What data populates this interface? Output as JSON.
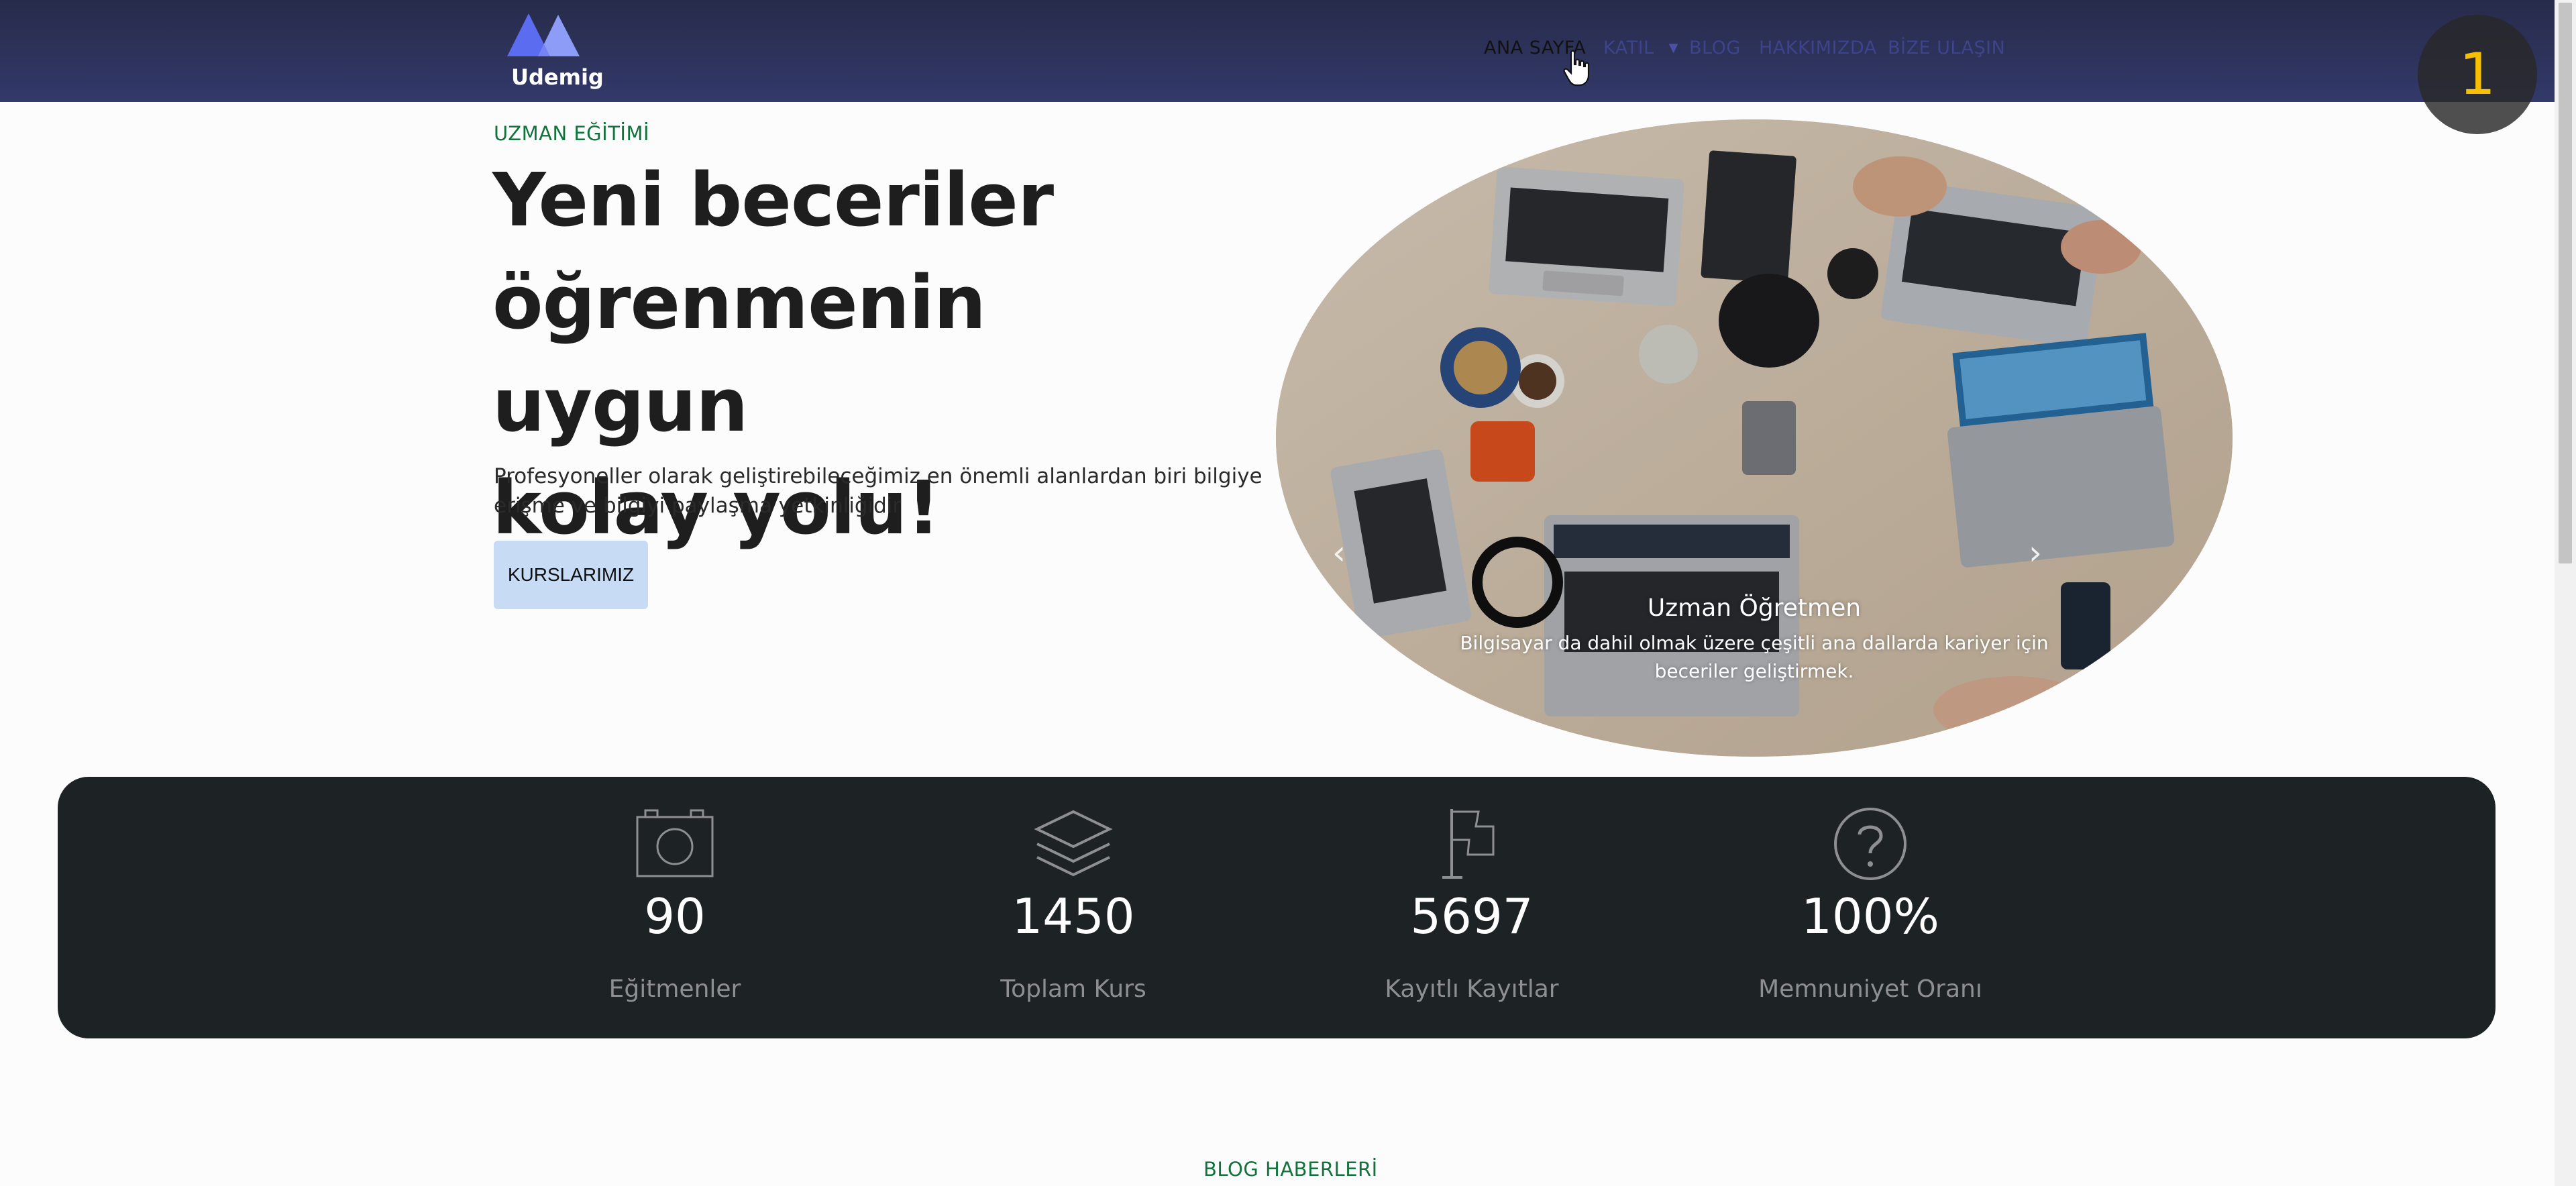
{
  "brand": {
    "name": "Udemig"
  },
  "nav": {
    "items": [
      {
        "label": "ANA SAYFA",
        "active": true
      },
      {
        "label": "KATIL",
        "has_dropdown": true
      },
      {
        "label": "BLOG"
      },
      {
        "label": "HAKKIMIZDA"
      },
      {
        "label": "BİZE ULAŞIN"
      }
    ]
  },
  "step_badge": "1",
  "hero": {
    "eyebrow": "UZMAN EĞİTİMİ",
    "title_lines": [
      "Yeni beceriler",
      "öğrenmenin uygun",
      "kolay yolu!"
    ],
    "description": "Profesyoneller olarak geliştirebileceğimiz en önemli alanlardan biri bilgiye erişme ve bilgiyi paylaşma yetkinliğidir",
    "button_label": "KURSLARIMIZ"
  },
  "carousel": {
    "caption_title": "Uzman Öğretmen",
    "caption_text": "Bilgisayar da dahil olmak üzere çeşitli ana dallarda kariyer için beceriler geliştirmek."
  },
  "stats": [
    {
      "icon": "camera-icon",
      "value": "90",
      "label": "Eğitmenler"
    },
    {
      "icon": "layers-icon",
      "value": "1450",
      "label": "Toplam Kurs"
    },
    {
      "icon": "flag-icon",
      "value": "5697",
      "label": "Kayıtlı Kayıtlar"
    },
    {
      "icon": "question-circle-icon",
      "value": "100%",
      "label": "Memnuniyet Oranı"
    }
  ],
  "blog_section": {
    "eyebrow": "BLOG HABERLERİ"
  },
  "colors": {
    "navbar": "#2d325a",
    "accent_green": "#11723c",
    "stats_bg": "#1d2224",
    "button_bg": "#c8dbf5",
    "badge_digit": "#f7c000"
  }
}
